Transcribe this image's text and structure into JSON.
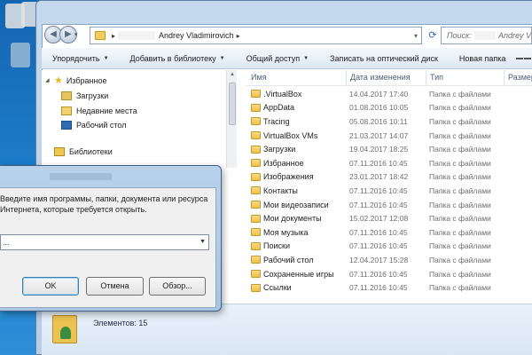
{
  "explorer": {
    "address": {
      "crumb": "Andrey Vladimirovich"
    },
    "search": {
      "placeholder_prefix": "Поиск:",
      "placeholder_suffix": "Andrey V"
    },
    "toolbar": [
      {
        "label": "Упорядочить",
        "has_caret": true
      },
      {
        "label": "Добавить в библиотеку",
        "has_caret": true
      },
      {
        "label": "Общий доступ",
        "has_caret": true
      },
      {
        "label": "Записать на оптический диск",
        "has_caret": false
      },
      {
        "label": "Новая папка",
        "has_caret": false
      }
    ],
    "nav": {
      "favorites": "Избранное",
      "downloads": "Загрузки",
      "recent": "Недавние места",
      "desktop": "Рабочий стол",
      "libraries": "Библиотеки"
    },
    "columns": {
      "name": "Имя",
      "date": "Дата изменения",
      "type": "Тип",
      "size": "Размер"
    },
    "files": [
      {
        "name": ".VirtualBox",
        "date": "14.04.2017 17:40",
        "type": "Папка с файлами"
      },
      {
        "name": "AppData",
        "date": "01.08.2016 10:05",
        "type": "Папка с файлами"
      },
      {
        "name": "Tracing",
        "date": "05.08.2016 10:11",
        "type": "Папка с файлами"
      },
      {
        "name": "VirtualBox VMs",
        "date": "21.03.2017 14:07",
        "type": "Папка с файлами"
      },
      {
        "name": "Загрузки",
        "date": "19.04.2017 18:25",
        "type": "Папка с файлами"
      },
      {
        "name": "Избранное",
        "date": "07.11.2016 10:45",
        "type": "Папка с файлами"
      },
      {
        "name": "Изображения",
        "date": "23.01.2017 18:42",
        "type": "Папка с файлами"
      },
      {
        "name": "Контакты",
        "date": "07.11.2016 10:45",
        "type": "Папка с файлами"
      },
      {
        "name": "Мои видеозаписи",
        "date": "07.11.2016 10:45",
        "type": "Папка с файлами"
      },
      {
        "name": "Мои документы",
        "date": "15.02.2017 12:08",
        "type": "Папка с файлами"
      },
      {
        "name": "Моя музыка",
        "date": "07.11.2016 10:45",
        "type": "Папка с файлами"
      },
      {
        "name": "Поиски",
        "date": "07.11.2016 10:45",
        "type": "Папка с файлами"
      },
      {
        "name": "Рабочий стол",
        "date": "12.04.2017 15:28",
        "type": "Папка с файлами"
      },
      {
        "name": "Сохраненные игры",
        "date": "07.11.2016 10:45",
        "type": "Папка с файлами"
      },
      {
        "name": "Ссылки",
        "date": "07.11.2016 10:45",
        "type": "Папка с файлами"
      }
    ],
    "status": {
      "count": "Элементов: 15"
    }
  },
  "run_dialog": {
    "prompt_line1": "Введите имя программы, папки, документа или ресурса",
    "prompt_line2": "Интернета, которые требуется открыть.",
    "input_value": "...",
    "ok_label": "OK",
    "cancel_label": "Отмена",
    "browse_label": "Обзор..."
  },
  "colors": {
    "desktop": "#1c7bc8",
    "window_frame": "#b7cde6",
    "folder": "#eec14a",
    "header_text": "#4c5f7a"
  }
}
